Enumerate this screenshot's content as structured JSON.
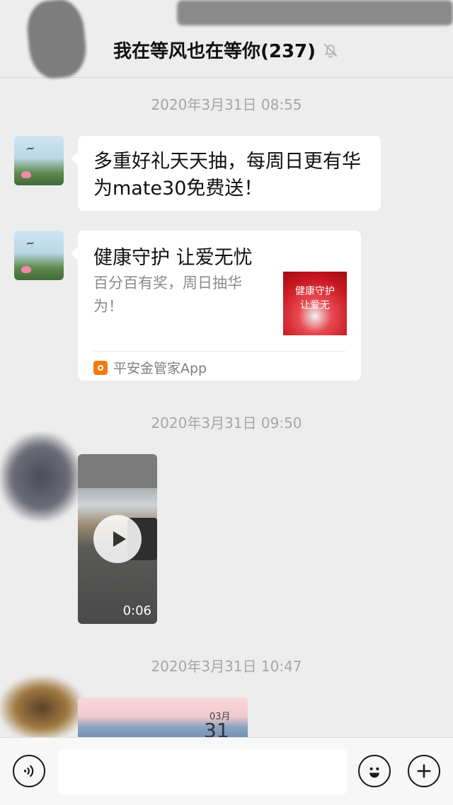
{
  "header": {
    "title": "我在等风也在等你(237)",
    "mute_icon": "bell-muted-icon"
  },
  "messages": {
    "timestamp_1": "2020年3月31日 08:55",
    "text_message": "多重好礼天天抽，每周日更有华为mate30免费送！",
    "link_card": {
      "title": "健康守护 让爱无忧",
      "description": "百分百有奖，周日抽华为！",
      "thumbnail_text": "健康守护\n让爱无",
      "source_app": "平安金管家App",
      "source_icon_color": "#f07b12"
    },
    "timestamp_2": "2020年3月31日 09:50",
    "video": {
      "duration": "0:06"
    },
    "timestamp_3": "2020年3月31日 10:47",
    "partial_card": {
      "calendar_month": "03月",
      "calendar_day": "31"
    }
  },
  "input_bar": {
    "voice_icon": "voice-icon",
    "emoji_icon": "emoji-icon",
    "plus_icon": "plus-icon"
  }
}
